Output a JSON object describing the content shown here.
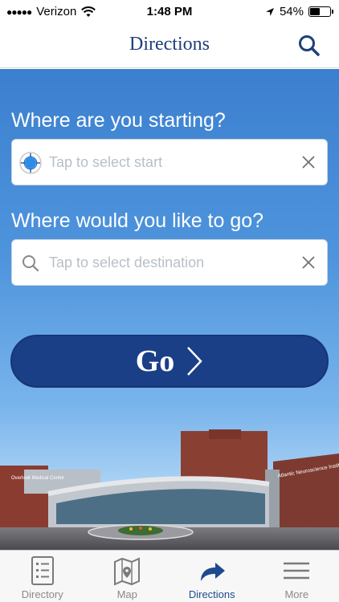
{
  "status": {
    "carrier": "Verizon",
    "time": "1:48 PM",
    "battery_text": "54%",
    "battery_level": 0.54
  },
  "nav": {
    "title": "Directions",
    "search_icon": "search-icon"
  },
  "form": {
    "start_label": "Where are you starting?",
    "start_placeholder": "Tap to select start",
    "start_value": "",
    "dest_label": "Where would you like to go?",
    "dest_placeholder": "Tap to select destination",
    "dest_value": ""
  },
  "go_button": {
    "label": "Go",
    "icon": "chevron-right-icon"
  },
  "building_signs": {
    "left": "Overlook Medical Center",
    "right": "Atlantic Neuroscience Institute"
  },
  "tabs": [
    {
      "label": "Directory",
      "icon": "directory-list-icon"
    },
    {
      "label": "Map",
      "icon": "map-icon"
    },
    {
      "label": "Directions",
      "icon": "directions-arrow-icon",
      "active": true
    },
    {
      "label": "More",
      "icon": "menu-icon"
    }
  ],
  "colors": {
    "brand_navy": "#1b3f86",
    "title_blue": "#1f3f7a",
    "active_tab": "#1f4a8f",
    "sky_top": "#3b7fcf"
  }
}
